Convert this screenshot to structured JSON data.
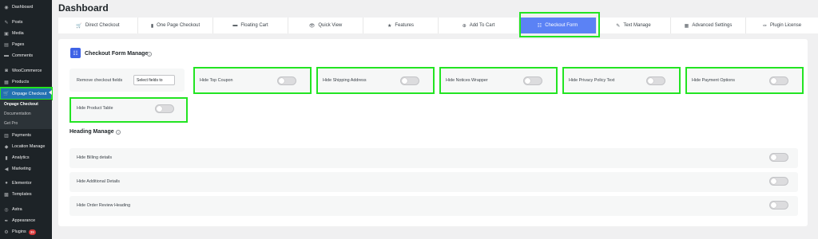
{
  "sidebar": {
    "items": [
      {
        "label": "Dashboard",
        "icon": "dashboard-icon",
        "glyph": "◉"
      },
      {
        "label": "Posts",
        "icon": "pin-icon",
        "glyph": "✎"
      },
      {
        "label": "Media",
        "icon": "media-icon",
        "glyph": "▣"
      },
      {
        "label": "Pages",
        "icon": "pages-icon",
        "glyph": "▤"
      },
      {
        "label": "Comments",
        "icon": "comments-icon",
        "glyph": "▬"
      },
      {
        "label": "WooCommerce",
        "icon": "woo-icon",
        "glyph": "◙"
      },
      {
        "label": "Products",
        "icon": "products-icon",
        "glyph": "▦"
      },
      {
        "label": "Onpage Checkout",
        "icon": "cart-icon",
        "glyph": "🛒"
      },
      {
        "label": "Payments",
        "icon": "payments-icon",
        "glyph": "▥"
      },
      {
        "label": "Location Manage",
        "icon": "location-icon",
        "glyph": "◆"
      },
      {
        "label": "Analytics",
        "icon": "analytics-icon",
        "glyph": "▮"
      },
      {
        "label": "Marketing",
        "icon": "marketing-icon",
        "glyph": "◀"
      },
      {
        "label": "Elementor",
        "icon": "elementor-icon",
        "glyph": "●"
      },
      {
        "label": "Templates",
        "icon": "templates-icon",
        "glyph": "▩"
      },
      {
        "label": "Astra",
        "icon": "astra-icon",
        "glyph": "◎"
      },
      {
        "label": "Appearance",
        "icon": "appearance-icon",
        "glyph": "✒"
      },
      {
        "label": "Plugins",
        "icon": "plugins-icon",
        "glyph": "⚙",
        "badge": "39"
      }
    ],
    "submenu": [
      "Onpage Checkout",
      "Documentation",
      "Get Pro"
    ]
  },
  "header": {
    "title": "Dashboard"
  },
  "tabs": [
    {
      "label": "Direct Checkout",
      "icon": "cart-icon",
      "glyph": "🛒"
    },
    {
      "label": "One Page Checkout",
      "icon": "file-icon",
      "glyph": "▮"
    },
    {
      "label": "Floating Cart",
      "icon": "floating-cart-icon",
      "glyph": "▬"
    },
    {
      "label": "Quick View",
      "icon": "eye-icon",
      "glyph": "👁"
    },
    {
      "label": "Features",
      "icon": "star-icon",
      "glyph": "★"
    },
    {
      "label": "Add To Cart",
      "icon": "plus-circle-icon",
      "glyph": "⊕"
    },
    {
      "label": "Checkout Form",
      "icon": "form-icon",
      "glyph": "☷",
      "active": true
    },
    {
      "label": "Text Manage",
      "icon": "pencil-icon",
      "glyph": "✎"
    },
    {
      "label": "Advanced Settings",
      "icon": "settings-icon",
      "glyph": "▦"
    },
    {
      "label": "Plugin License",
      "icon": "key-icon",
      "glyph": "✑"
    }
  ],
  "checkout_form": {
    "title": "Checkout Form Manage",
    "remove_fields": {
      "label": "Remove checkout fields",
      "placeholder": "Select fields to"
    },
    "toggles": [
      {
        "label": "Hide Top Coupon",
        "on": false
      },
      {
        "label": "Hide Shipping Address",
        "on": false
      },
      {
        "label": "Hide Notices Wrapper",
        "on": false
      },
      {
        "label": "Hide Privacy Policy Text",
        "on": false
      },
      {
        "label": "Hide Payment Options",
        "on": false
      },
      {
        "label": "Hide Product Table",
        "on": false
      }
    ]
  },
  "heading_manage": {
    "title": "Heading Manage",
    "rows": [
      {
        "label": "Hide Billing details",
        "on": false
      },
      {
        "label": "Hide Additional Details",
        "on": false
      },
      {
        "label": "Hide Order Review Heading",
        "on": false
      }
    ]
  },
  "colors": {
    "accent": "#5b82f5",
    "sidebar_bg": "#1d2327",
    "highlight": "#22e422",
    "wp_blue": "#2271b1"
  }
}
